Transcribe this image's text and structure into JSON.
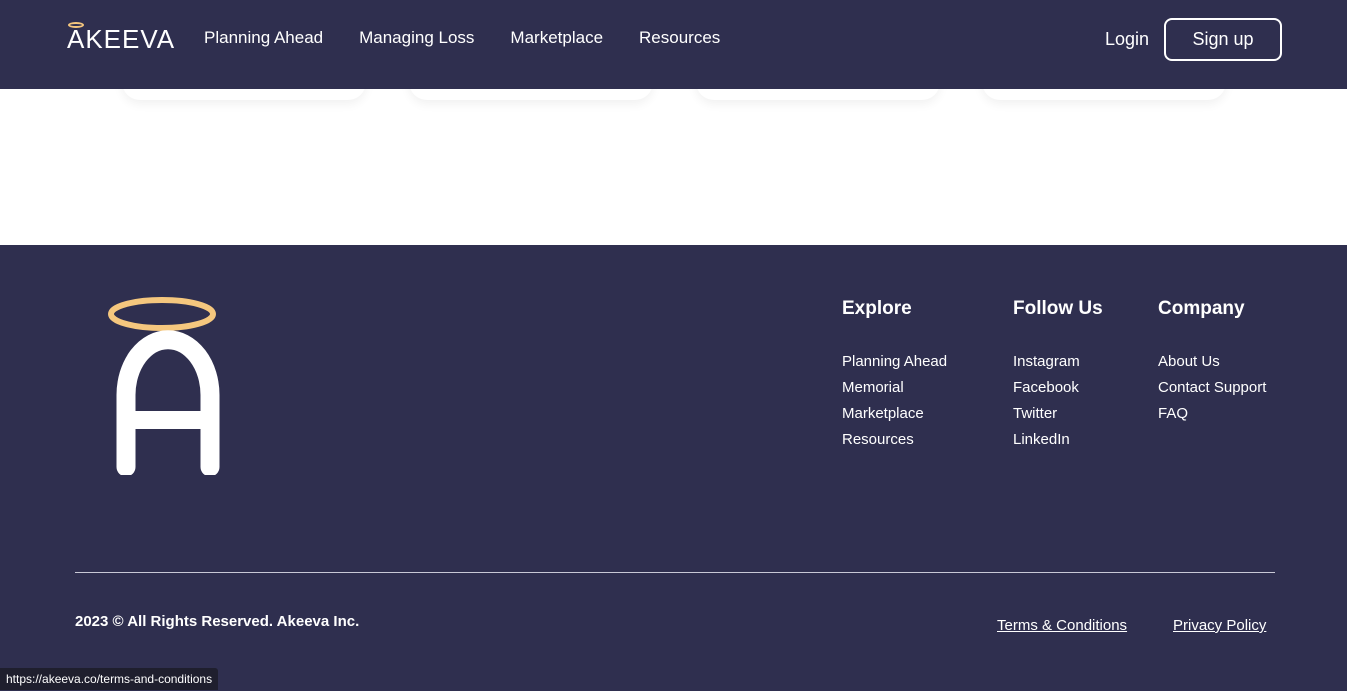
{
  "header": {
    "logo_text": "AKEEVA",
    "nav": [
      {
        "label": "Planning Ahead"
      },
      {
        "label": "Managing Loss"
      },
      {
        "label": "Marketplace"
      },
      {
        "label": "Resources"
      }
    ],
    "login_label": "Login",
    "signup_label": "Sign up"
  },
  "footer": {
    "columns": [
      {
        "title": "Explore",
        "links": [
          "Planning Ahead",
          "Memorial",
          "Marketplace",
          "Resources"
        ]
      },
      {
        "title": "Follow Us",
        "links": [
          "Instagram",
          "Facebook",
          "Twitter",
          "LinkedIn"
        ]
      },
      {
        "title": "Company",
        "links": [
          "About Us",
          "Contact Support",
          "FAQ"
        ]
      }
    ],
    "copyright": "2023 © All Rights Reserved. Akeeva Inc.",
    "terms_label": "Terms & Conditions",
    "privacy_label": "Privacy Policy"
  },
  "status_bar": {
    "url": "https://akeeva.co/terms-and-conditions"
  },
  "colors": {
    "brand_navy": "#2f2f4f",
    "halo_gold": "#f5c77e",
    "white": "#ffffff"
  }
}
